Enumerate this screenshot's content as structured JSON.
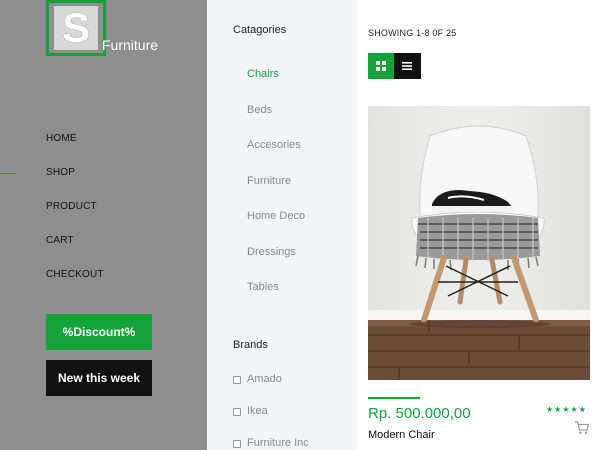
{
  "brand": {
    "logo_letter": "S",
    "logo_text": "Furniture",
    "accent_color": "#14a33a"
  },
  "nav": {
    "items": [
      {
        "label": "HOME"
      },
      {
        "label": "SHOP",
        "active": true
      },
      {
        "label": "PRODUCT"
      },
      {
        "label": "CART"
      },
      {
        "label": "CHECKOUT"
      }
    ],
    "discount_label": "%Discount%",
    "new_label": "New this week"
  },
  "categories": {
    "title": "Catagories",
    "items": [
      "Chairs",
      "Beds",
      "Accesories",
      "Furniture",
      "Home Deco",
      "Dressings",
      "Tables"
    ],
    "active": "Chairs"
  },
  "brands": {
    "title": "Brands",
    "items": [
      "Amado",
      "Ikea",
      "Furniture Inc"
    ]
  },
  "toolbar": {
    "showing": "SHOWING 1-8 0F 25",
    "grid_icon": "grid-view-icon",
    "list_icon": "list-view-icon"
  },
  "product": {
    "price": "Rp. 500.000,00",
    "name": "Modern Chair",
    "rating": 5,
    "stars": "★★★★★",
    "cart_icon": "cart-icon"
  }
}
